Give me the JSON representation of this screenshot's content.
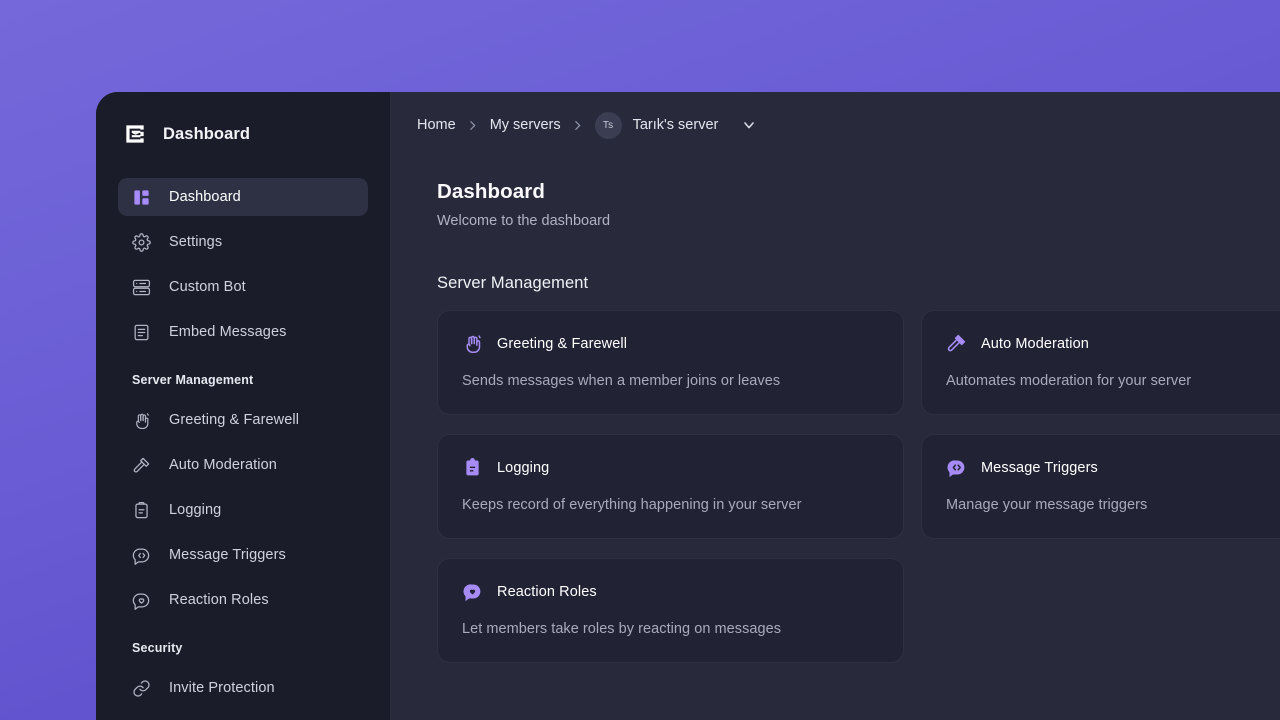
{
  "theme": {
    "backdrop_purple": "#6C5FD6",
    "sidebar_bg": "#1B1C29",
    "main_bg": "#282A3C",
    "card_bg": "#212334",
    "accent_purple": "#A68BF5",
    "active_nav_bg": "#2E3043"
  },
  "sidebar": {
    "brand": {
      "logo_icon": "app-logo-icon",
      "title": "Dashboard"
    },
    "items": [
      {
        "label": "Dashboard",
        "icon": "layout-dashboard-icon",
        "active": true
      },
      {
        "label": "Settings",
        "icon": "gear-icon",
        "active": false
      },
      {
        "label": "Custom Bot",
        "icon": "server-rack-icon",
        "active": false
      },
      {
        "label": "Embed Messages",
        "icon": "document-lines-icon",
        "active": false
      }
    ],
    "sections": [
      {
        "title": "Server Management",
        "items": [
          {
            "label": "Greeting & Farewell",
            "icon": "waving-hand-icon"
          },
          {
            "label": "Auto Moderation",
            "icon": "gavel-icon"
          },
          {
            "label": "Logging",
            "icon": "clipboard-icon"
          },
          {
            "label": "Message Triggers",
            "icon": "code-bubble-icon"
          },
          {
            "label": "Reaction Roles",
            "icon": "heart-bubble-icon"
          }
        ]
      },
      {
        "title": "Security",
        "items": [
          {
            "label": "Invite Protection",
            "icon": "link-icon"
          }
        ]
      }
    ]
  },
  "breadcrumb": {
    "home": "Home",
    "my_servers": "My servers",
    "separator_icon": "chevron-right-icon",
    "server": {
      "avatar_initials": "Ts",
      "name": "Tarık's server",
      "dropdown_icon": "chevron-down-icon"
    }
  },
  "page": {
    "title": "Dashboard",
    "subtitle": "Welcome to the dashboard",
    "section_title": "Server Management",
    "cards": [
      {
        "title": "Greeting & Farewell",
        "description": "Sends messages when a member joins or leaves",
        "icon": "waving-hand-icon"
      },
      {
        "title": "Auto Moderation",
        "description": "Automates moderation for your server",
        "icon": "gavel-icon"
      },
      {
        "title": "Logging",
        "description": "Keeps record of everything happening in your server",
        "icon": "clipboard-icon"
      },
      {
        "title": "Message Triggers",
        "description": "Manage your message triggers",
        "icon": "code-bubble-icon"
      },
      {
        "title": "Reaction Roles",
        "description": "Let members take roles by reacting on messages",
        "icon": "heart-bubble-icon"
      }
    ]
  }
}
